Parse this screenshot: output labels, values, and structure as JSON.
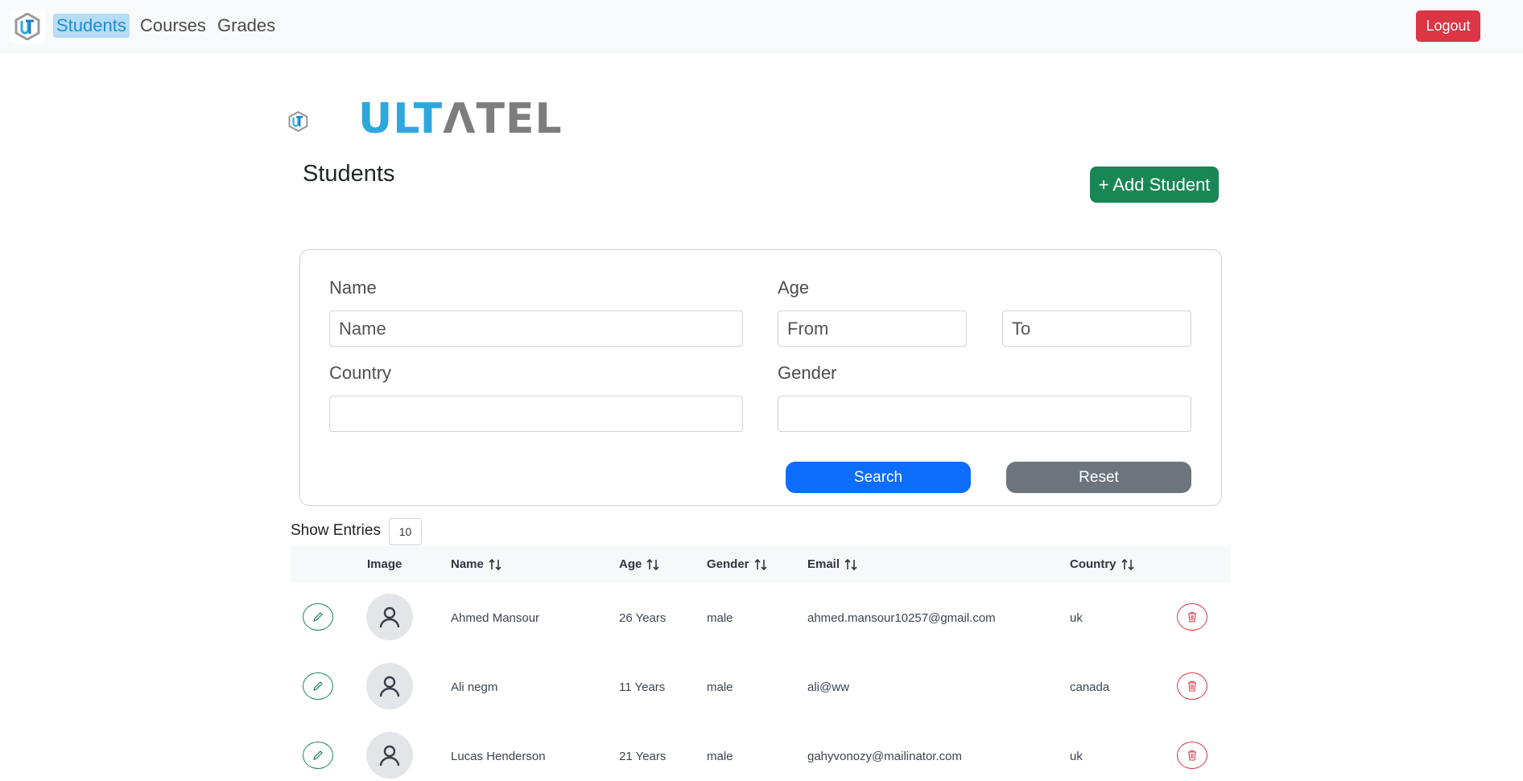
{
  "nav": {
    "links": [
      {
        "label": "Students",
        "active": true
      },
      {
        "label": "Courses",
        "active": false
      },
      {
        "label": "Grades",
        "active": false
      }
    ],
    "logout": "Logout"
  },
  "brand": {
    "part1": "ULT",
    "part2": "ΛTEL"
  },
  "page": {
    "title": "Students",
    "add_button": "+ Add Student"
  },
  "filters": {
    "name_label": "Name",
    "name_placeholder": "Name",
    "age_label": "Age",
    "age_from_placeholder": "From",
    "age_to_placeholder": "To",
    "country_label": "Country",
    "country_value": "",
    "gender_label": "Gender",
    "gender_value": "",
    "search_button": "Search",
    "reset_button": "Reset"
  },
  "entries": {
    "label": "Show Entries",
    "value": "10"
  },
  "table": {
    "headers": {
      "image": "Image",
      "name": "Name",
      "age": "Age",
      "gender": "Gender",
      "email": "Email",
      "country": "Country"
    },
    "rows": [
      {
        "name": "Ahmed Mansour",
        "age": "26 Years",
        "gender": "male",
        "email": "ahmed.mansour10257@gmail.com",
        "country": "uk"
      },
      {
        "name": "Ali negm",
        "age": "11 Years",
        "gender": "male",
        "email": "ali@ww",
        "country": "canada"
      },
      {
        "name": "Lucas Henderson",
        "age": "21 Years",
        "gender": "male",
        "email": "gahyvonozy@mailinator.com",
        "country": "uk"
      }
    ]
  },
  "colors": {
    "primary": "#0d6efd",
    "success": "#198754",
    "danger": "#dc3545",
    "secondary": "#6c757d",
    "brand_blue": "#2ea7df",
    "brand_gray": "#7d7d7d"
  }
}
